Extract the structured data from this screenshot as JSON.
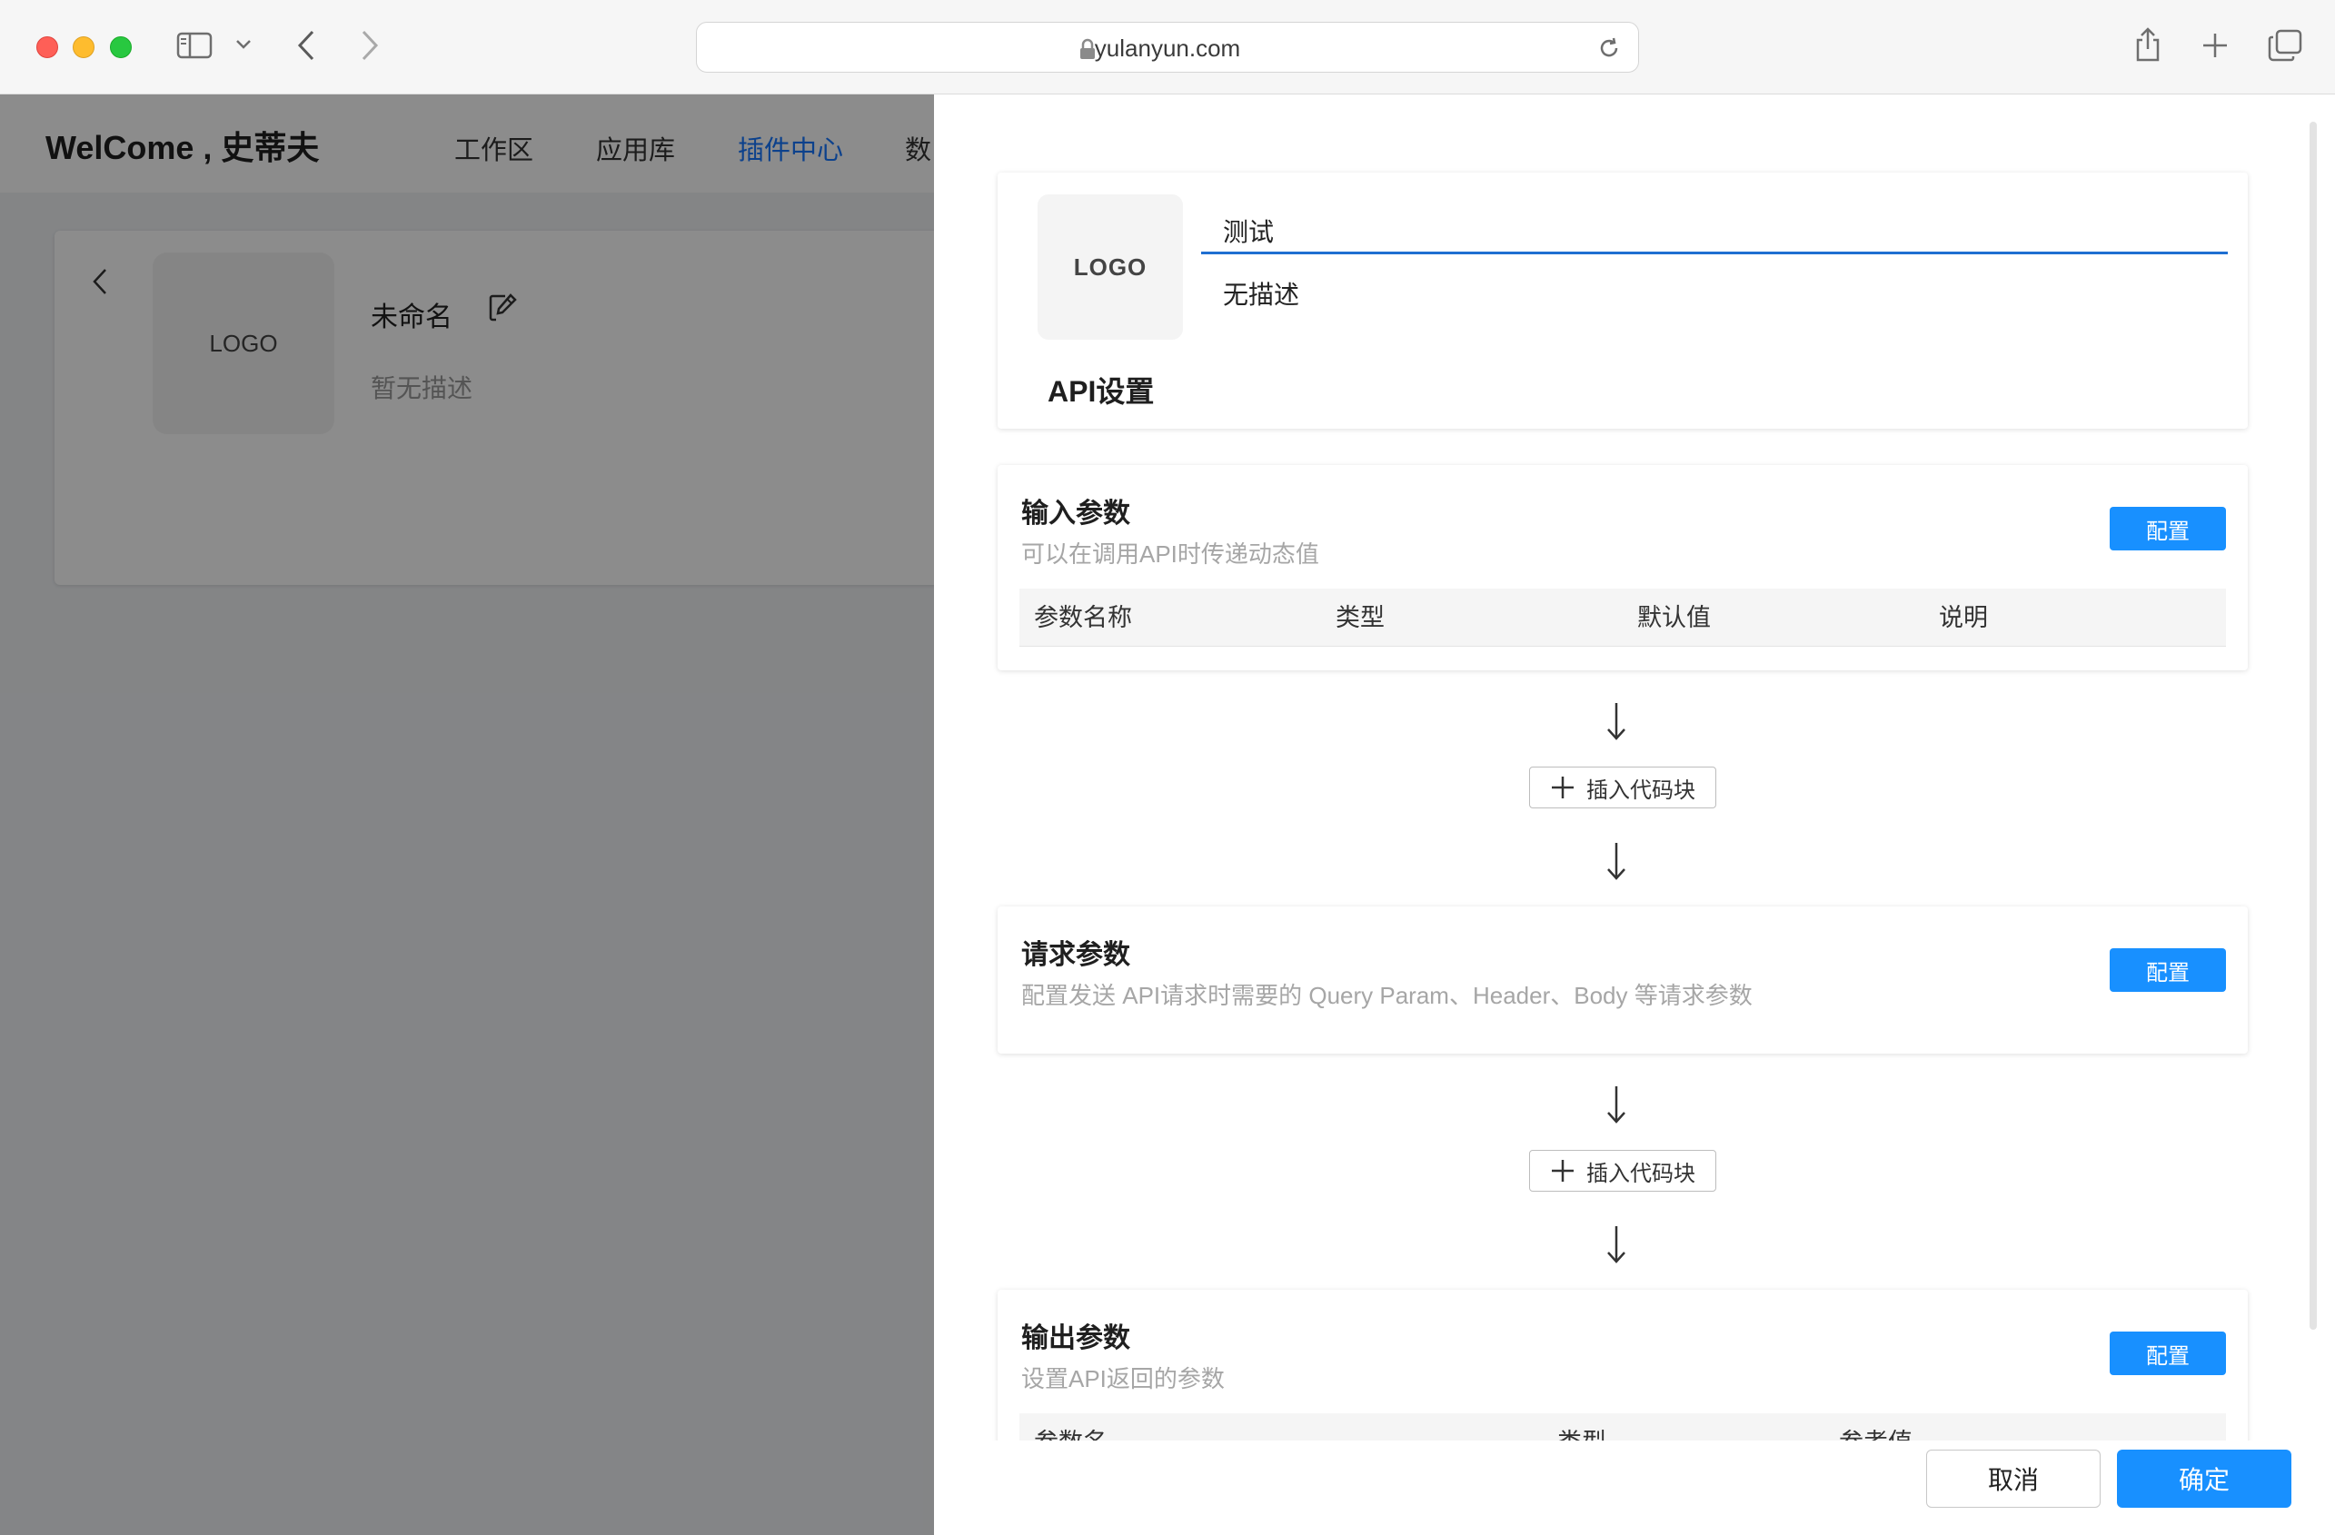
{
  "browser": {
    "url": "yulanyun.com",
    "icons": [
      "sidebar-icon",
      "chevron-down-icon",
      "back-icon",
      "forward-icon",
      "lock-icon",
      "reload-icon",
      "share-icon",
      "new-tab-icon",
      "tabs-overview-icon"
    ]
  },
  "app": {
    "welcome": "WelCome , 史蒂夫",
    "nav": [
      {
        "label": "工作区"
      },
      {
        "label": "应用库"
      },
      {
        "label": "插件中心",
        "active": true
      },
      {
        "label": "数"
      }
    ],
    "plugin": {
      "logo": "LOGO",
      "name": "未命名",
      "description": "暂无描述"
    }
  },
  "drawer": {
    "logo": "LOGO",
    "name_value": "测试",
    "description_value": "无描述",
    "api_title": "API设置",
    "input_params": {
      "title": "输入参数",
      "subtitle": "可以在调用API时传递动态值",
      "config_label": "配置",
      "columns": [
        "参数名称",
        "类型",
        "默认值",
        "说明"
      ]
    },
    "insert_block_label": "插入代码块",
    "request_params": {
      "title": "请求参数",
      "subtitle": "配置发送 API请求时需要的 Query Param、Header、Body 等请求参数",
      "config_label": "配置"
    },
    "output_params": {
      "title": "输出参数",
      "subtitle": "设置API返回的参数",
      "config_label": "配置",
      "columns": [
        "参数名",
        "类型",
        "参考值"
      ]
    },
    "footer": {
      "cancel_label": "取消",
      "ok_label": "确定"
    }
  },
  "colors": {
    "primary": "#1890ff",
    "nav_active": "#1677ff",
    "input_underline": "#1f6fd1"
  }
}
